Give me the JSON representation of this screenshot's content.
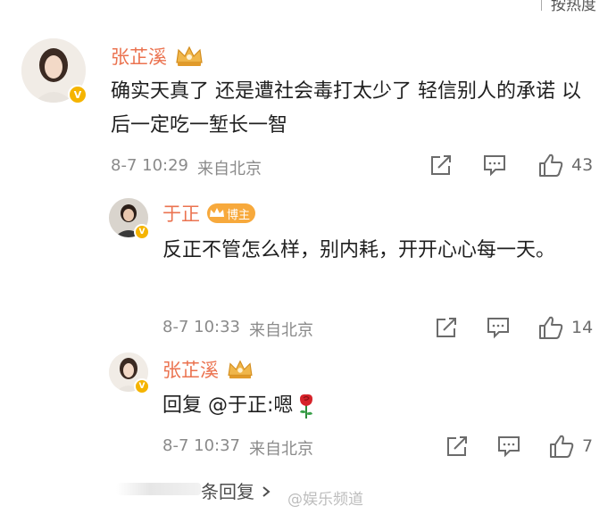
{
  "sort_bar": {
    "label": "按热度"
  },
  "comments": [
    {
      "name": "张芷溪",
      "text": "确实天真了 还是遭社会毒打太少了 轻信别人的承诺 以后一定吃一堑长一智",
      "time": "8-7 10:29",
      "source": "来自北京",
      "likes": "43"
    },
    {
      "name": "于正",
      "tag": "博主",
      "text": "反正不管怎么样，别内耗，开开心心每一天。",
      "time": "8-7 10:33",
      "source": "来自北京",
      "likes": "14"
    },
    {
      "name": "张芷溪",
      "text": "回复 @于正:嗯",
      "time": "8-7 10:37",
      "source": "来自北京",
      "likes": "7"
    }
  ],
  "footer": {
    "reply_count_label": "条回复",
    "watermark": "@娱乐频道"
  },
  "colors": {
    "username": "#eb7350",
    "vip_badge": "#f5b400",
    "meta_text": "#8a8a8a"
  },
  "icons": [
    "share-icon",
    "comment-icon",
    "like-icon",
    "crown-icon",
    "rose-emoji",
    "verified-badge-icon"
  ]
}
